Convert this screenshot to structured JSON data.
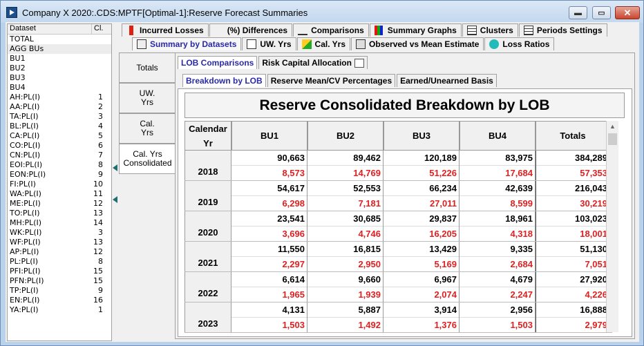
{
  "window": {
    "title": "Company X 2020:.CDS:MPTF[Optimal-1]:Reserve Forecast Summaries",
    "min_glyph": "▬",
    "max_glyph": "▭",
    "close_glyph": "✕"
  },
  "datasets": {
    "header": [
      "Dataset",
      "Cl."
    ],
    "rows": [
      {
        "name": "TOTAL",
        "cl": ""
      },
      {
        "name": "AGG BUs",
        "cl": ""
      },
      {
        "name": "BU1",
        "cl": ""
      },
      {
        "name": "BU2",
        "cl": ""
      },
      {
        "name": "BU3",
        "cl": ""
      },
      {
        "name": "BU4",
        "cl": ""
      },
      {
        "name": "AH:PL(I)",
        "cl": "1"
      },
      {
        "name": "AA:PL(I)",
        "cl": "2"
      },
      {
        "name": "TA:PL(I)",
        "cl": "3"
      },
      {
        "name": "BL:PL(I)",
        "cl": "4"
      },
      {
        "name": "CA:PL(I)",
        "cl": "5"
      },
      {
        "name": "CO:PL(I)",
        "cl": "6"
      },
      {
        "name": "CN:PL(I)",
        "cl": "7"
      },
      {
        "name": "EOI:PL(I)",
        "cl": "8"
      },
      {
        "name": "EON:PL(I)",
        "cl": "9"
      },
      {
        "name": "FI:PL(I)",
        "cl": "10"
      },
      {
        "name": "WA:PL(I)",
        "cl": "11"
      },
      {
        "name": "ME:PL(I)",
        "cl": "12"
      },
      {
        "name": "TO:PL(I)",
        "cl": "13"
      },
      {
        "name": "MH:PL(I)",
        "cl": "14"
      },
      {
        "name": "WK:PL(I)",
        "cl": "3"
      },
      {
        "name": "WF:PL(I)",
        "cl": "13"
      },
      {
        "name": "AP:PL(I)",
        "cl": "12"
      },
      {
        "name": "PL:PL(I)",
        "cl": "8"
      },
      {
        "name": "PFI:PL(I)",
        "cl": "15"
      },
      {
        "name": "PFN:PL(I)",
        "cl": "15"
      },
      {
        "name": "TP:PL(I)",
        "cl": "9"
      },
      {
        "name": "EN:PL(I)",
        "cl": "16"
      },
      {
        "name": "YA:PL(I)",
        "cl": "1"
      }
    ]
  },
  "tabs_row1": [
    {
      "label": "Incurred Losses",
      "icon": "red-bar-icon"
    },
    {
      "label": "(%) Differences",
      "icon": "xy-icon"
    },
    {
      "label": "Comparisons",
      "icon": "scale-icon"
    },
    {
      "label": "Summary Graphs",
      "icon": "bar-graph-icon"
    },
    {
      "label": "Clusters",
      "icon": "clusters-icon"
    },
    {
      "label": "Periods Settings",
      "icon": "periods-icon"
    }
  ],
  "tabs_row2": [
    {
      "label": "Summary by Datasets",
      "icon": "summary-icon"
    },
    {
      "label": "UW. Yrs",
      "icon": "uw-icon"
    },
    {
      "label": "Cal. Yrs",
      "icon": "cal-icon"
    },
    {
      "label": "Observed vs Mean Estimate",
      "icon": "observed-icon"
    },
    {
      "label": "Loss Ratios",
      "icon": "loss-ratio-icon"
    }
  ],
  "vnav": [
    {
      "label": "Totals"
    },
    {
      "label": "UW.\nYrs"
    },
    {
      "label": "Cal.\nYrs"
    },
    {
      "label": "Cal. Yrs\nConsolidated"
    }
  ],
  "subtabs1": [
    "LOB Comparisons",
    "Risk Capital Allocation"
  ],
  "subtabs2": [
    "Breakdown by LOB",
    "Reserve Mean/CV Percentages",
    "Earned/Unearned Basis"
  ],
  "grid": {
    "title": "Reserve Consolidated Breakdown by LOB",
    "year_header": "Calendar\nYr",
    "columns": [
      "BU1",
      "BU2",
      "BU3",
      "BU4",
      "Totals"
    ],
    "rows": [
      {
        "year": "2018",
        "top": [
          "90,663",
          "89,462",
          "120,189",
          "83,975",
          "384,289"
        ],
        "bottom": [
          "8,573",
          "14,769",
          "51,226",
          "17,684",
          "57,353"
        ]
      },
      {
        "year": "2019",
        "top": [
          "54,617",
          "52,553",
          "66,234",
          "42,639",
          "216,043"
        ],
        "bottom": [
          "6,298",
          "7,181",
          "27,011",
          "8,599",
          "30,219"
        ]
      },
      {
        "year": "2020",
        "top": [
          "23,541",
          "30,685",
          "29,837",
          "18,961",
          "103,023"
        ],
        "bottom": [
          "3,696",
          "4,746",
          "16,205",
          "4,318",
          "18,001"
        ]
      },
      {
        "year": "2021",
        "top": [
          "11,550",
          "16,815",
          "13,429",
          "9,335",
          "51,130"
        ],
        "bottom": [
          "2,297",
          "2,950",
          "5,169",
          "2,684",
          "7,051"
        ]
      },
      {
        "year": "2022",
        "top": [
          "6,614",
          "9,660",
          "6,967",
          "4,679",
          "27,920"
        ],
        "bottom": [
          "1,965",
          "1,939",
          "2,074",
          "2,247",
          "4,226"
        ]
      },
      {
        "year": "2023",
        "top": [
          "4,131",
          "5,887",
          "3,914",
          "2,956",
          "16,888"
        ],
        "bottom": [
          "1,503",
          "1,492",
          "1,376",
          "1,503",
          "2,979"
        ]
      }
    ]
  },
  "colors": {
    "accent": "#2a2aa8",
    "negative": "#e02020"
  }
}
